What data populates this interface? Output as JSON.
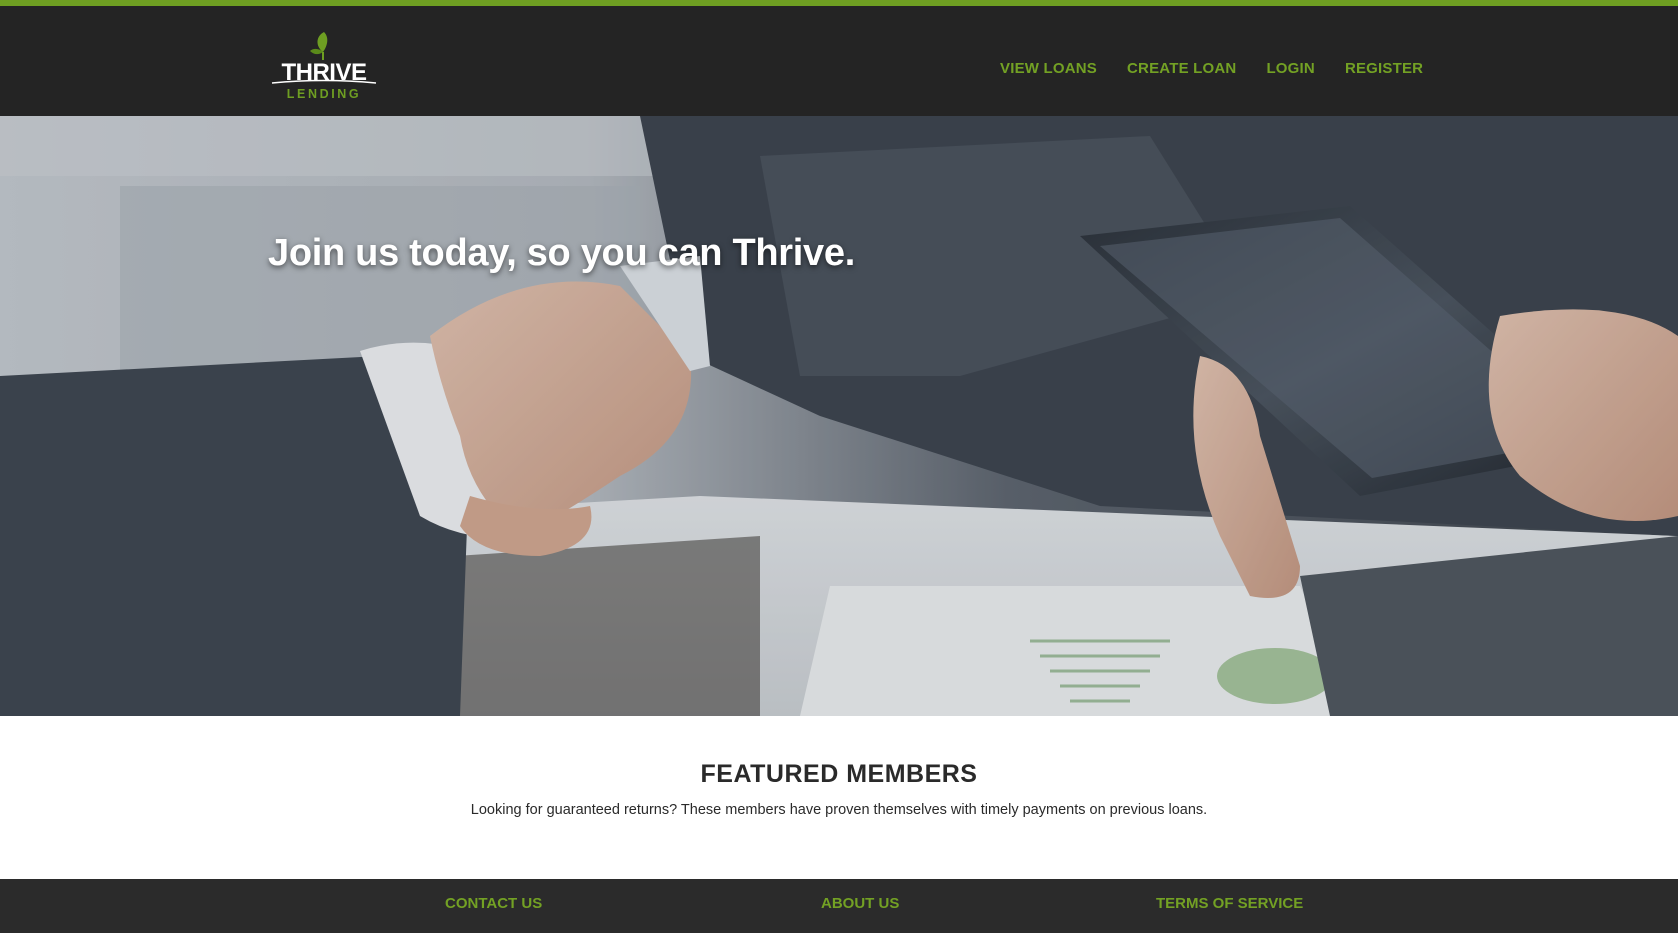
{
  "brand": {
    "logo_text": "THRIVE",
    "logo_subtext": "LENDING",
    "accent_color": "#6e9e22",
    "link_color": "#73a124",
    "nav_background": "#242424",
    "footer_background": "#2b2b2b"
  },
  "nav": {
    "items": [
      {
        "label": "VIEW LOANS"
      },
      {
        "label": "CREATE LOAN"
      },
      {
        "label": "LOGIN"
      },
      {
        "label": "REGISTER"
      }
    ]
  },
  "hero": {
    "heading": "Join us today, so you can Thrive.",
    "image": "handshake-with-tablet-photo"
  },
  "featured": {
    "title": "FEATURED MEMBERS",
    "subtitle": "Looking for guaranteed returns? These members have proven themselves with timely payments on previous loans."
  },
  "footer": {
    "links": [
      {
        "label": "CONTACT US"
      },
      {
        "label": "ABOUT US"
      },
      {
        "label": "TERMS OF SERVICE"
      }
    ]
  }
}
